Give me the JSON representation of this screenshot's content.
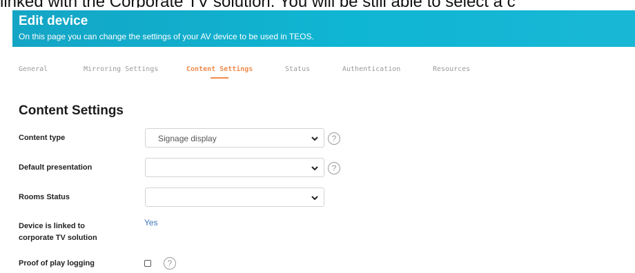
{
  "caption": "linked with the Corporate TV solution. You will be still able to select a c",
  "header": {
    "title": "Edit device",
    "subtitle": "On this page you can change the settings of your AV device to be used in TEOS."
  },
  "tabs": [
    {
      "label": "General",
      "active": false
    },
    {
      "label": "Mirroring Settings",
      "active": false
    },
    {
      "label": "Content Settings",
      "active": true
    },
    {
      "label": "Status",
      "active": false
    },
    {
      "label": "Authentication",
      "active": false
    },
    {
      "label": "Resources",
      "active": false
    }
  ],
  "section_title": "Content Settings",
  "fields": {
    "content_type": {
      "label": "Content type",
      "value": "Signage display"
    },
    "default_presentation": {
      "label": "Default presentation",
      "value": ""
    },
    "rooms_status": {
      "label": "Rooms Status",
      "value": ""
    },
    "linked": {
      "label_line1": "Device is linked to",
      "label_line2": "corporate TV solution",
      "value": "Yes"
    },
    "proof_of_play": {
      "label": "Proof of play logging",
      "checked": false
    }
  },
  "help_glyph": "?",
  "colors": {
    "header_bg": "#14a5c5",
    "active_tab": "#f08a4b",
    "link": "#3b74b8"
  }
}
